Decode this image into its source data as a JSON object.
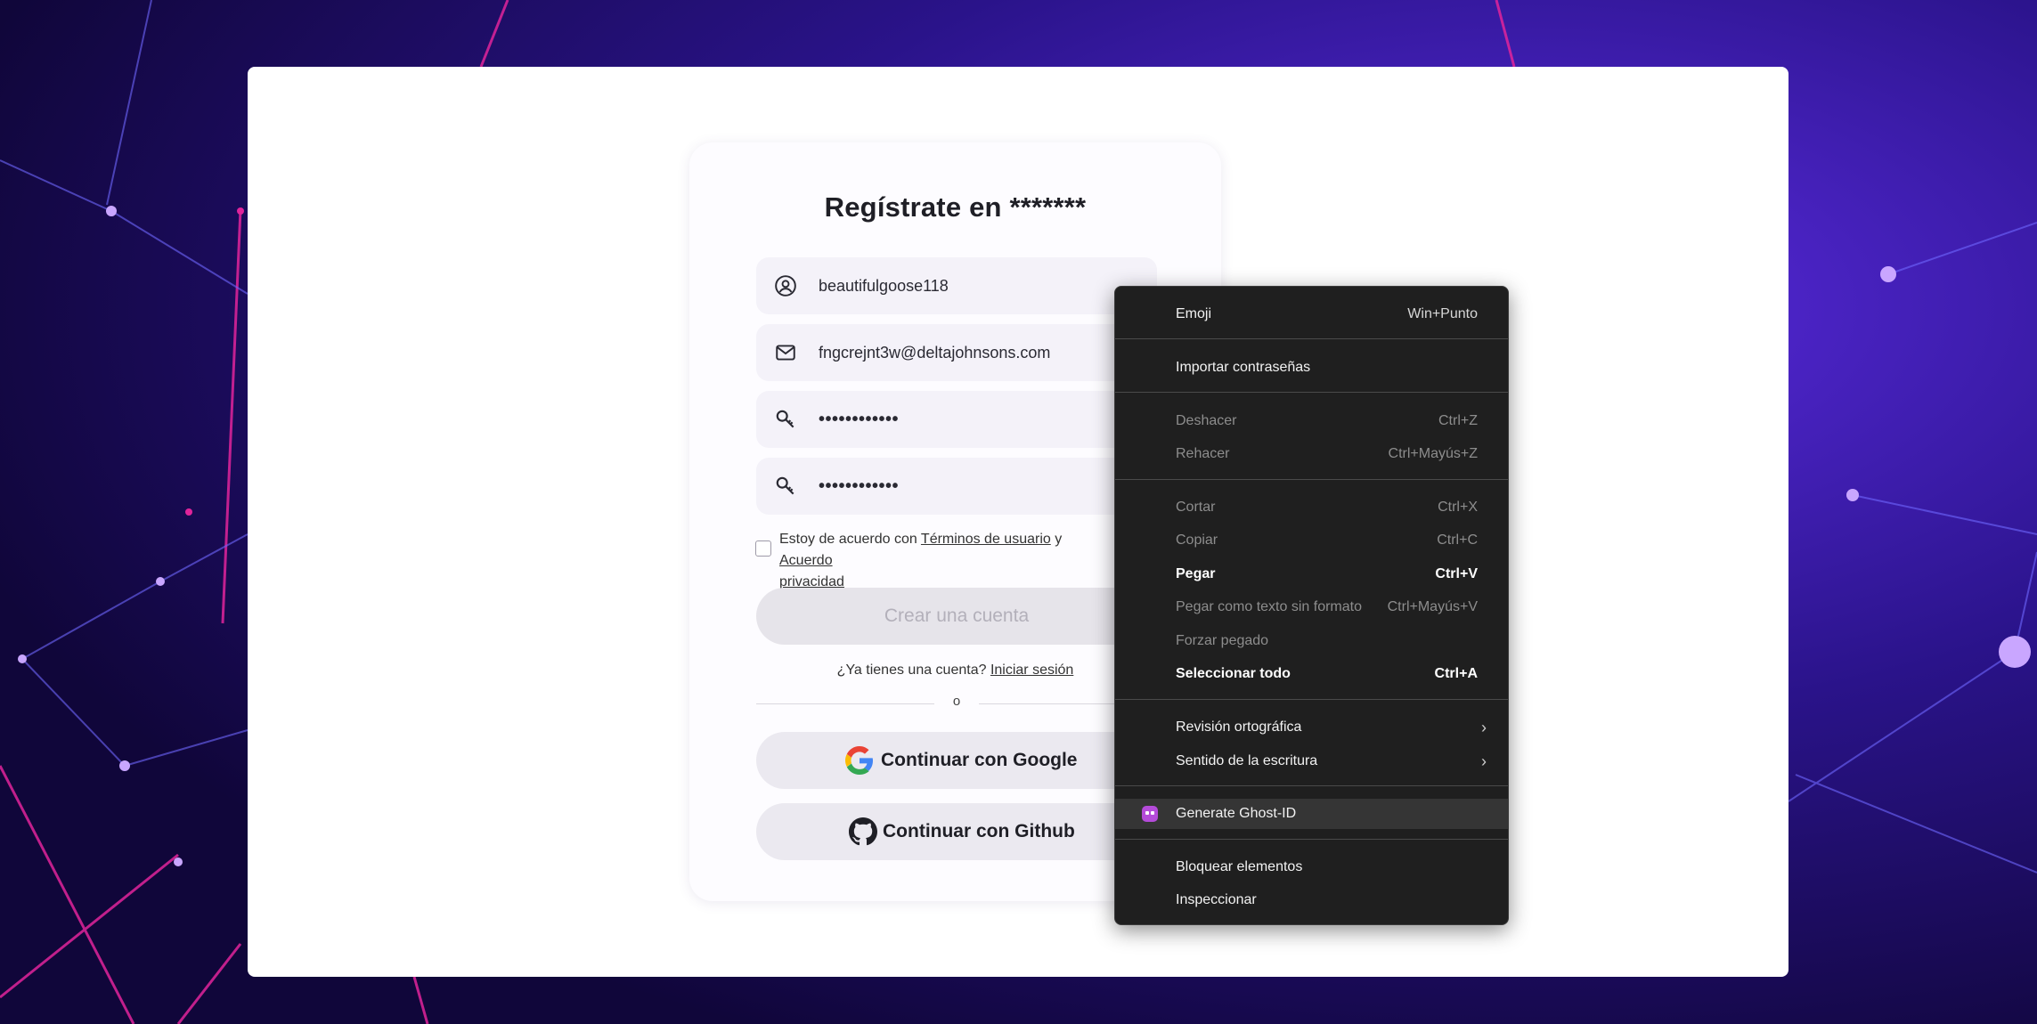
{
  "form": {
    "title": "Regístrate en *******",
    "username_value": "beautifulgoose118",
    "email_value": "fngcrejnt3w@deltajohnsons.com",
    "password_value": "••••••••••••",
    "confirm_password_value": "••••••••••••",
    "terms_prefix": "Estoy de acuerdo con ",
    "terms_link": "Términos de usuario",
    "terms_and": " y ",
    "privacy_link_part1": "Acuerdo",
    "privacy_link_part2": "privacidad",
    "create_button": "Crear una cuenta",
    "have_account": "¿Ya tienes una cuenta? ",
    "login_link": "Iniciar sesión",
    "divider_text": "o",
    "google_button": "Continuar con Google",
    "github_button": "Continuar con Github"
  },
  "context_menu": {
    "items": [
      {
        "label": "Emoji",
        "shortcut": "Win+Punto"
      },
      {
        "label": "Importar contraseñas",
        "shortcut": ""
      },
      {
        "label": "Deshacer",
        "shortcut": "Ctrl+Z"
      },
      {
        "label": "Rehacer",
        "shortcut": "Ctrl+Mayús+Z"
      },
      {
        "label": "Cortar",
        "shortcut": "Ctrl+X"
      },
      {
        "label": "Copiar",
        "shortcut": "Ctrl+C"
      },
      {
        "label": "Pegar",
        "shortcut": "Ctrl+V"
      },
      {
        "label": "Pegar como texto sin formato",
        "shortcut": "Ctrl+Mayús+V"
      },
      {
        "label": "Forzar pegado",
        "shortcut": ""
      },
      {
        "label": "Seleccionar todo",
        "shortcut": "Ctrl+A"
      },
      {
        "label": "Revisión ortográfica",
        "shortcut": ""
      },
      {
        "label": "Sentido de la escritura",
        "shortcut": ""
      },
      {
        "label": "Generate Ghost-ID",
        "shortcut": ""
      },
      {
        "label": "Bloquear elementos",
        "shortcut": ""
      },
      {
        "label": "Inspeccionar",
        "shortcut": ""
      }
    ]
  },
  "icons": {
    "username": "user-circle-icon",
    "email": "mail-icon",
    "password": "key-icon",
    "google": "google-icon",
    "github": "github-icon",
    "ghost": "ghost-icon",
    "submenu": "chevron-right-icon"
  },
  "colors": {
    "background_dark": "#1a0b4d",
    "background_accent": "#6a2bff",
    "line_pink": "#e0249b",
    "menu_bg": "#1f1f1f",
    "ghost_purple": "#b44bd9"
  }
}
